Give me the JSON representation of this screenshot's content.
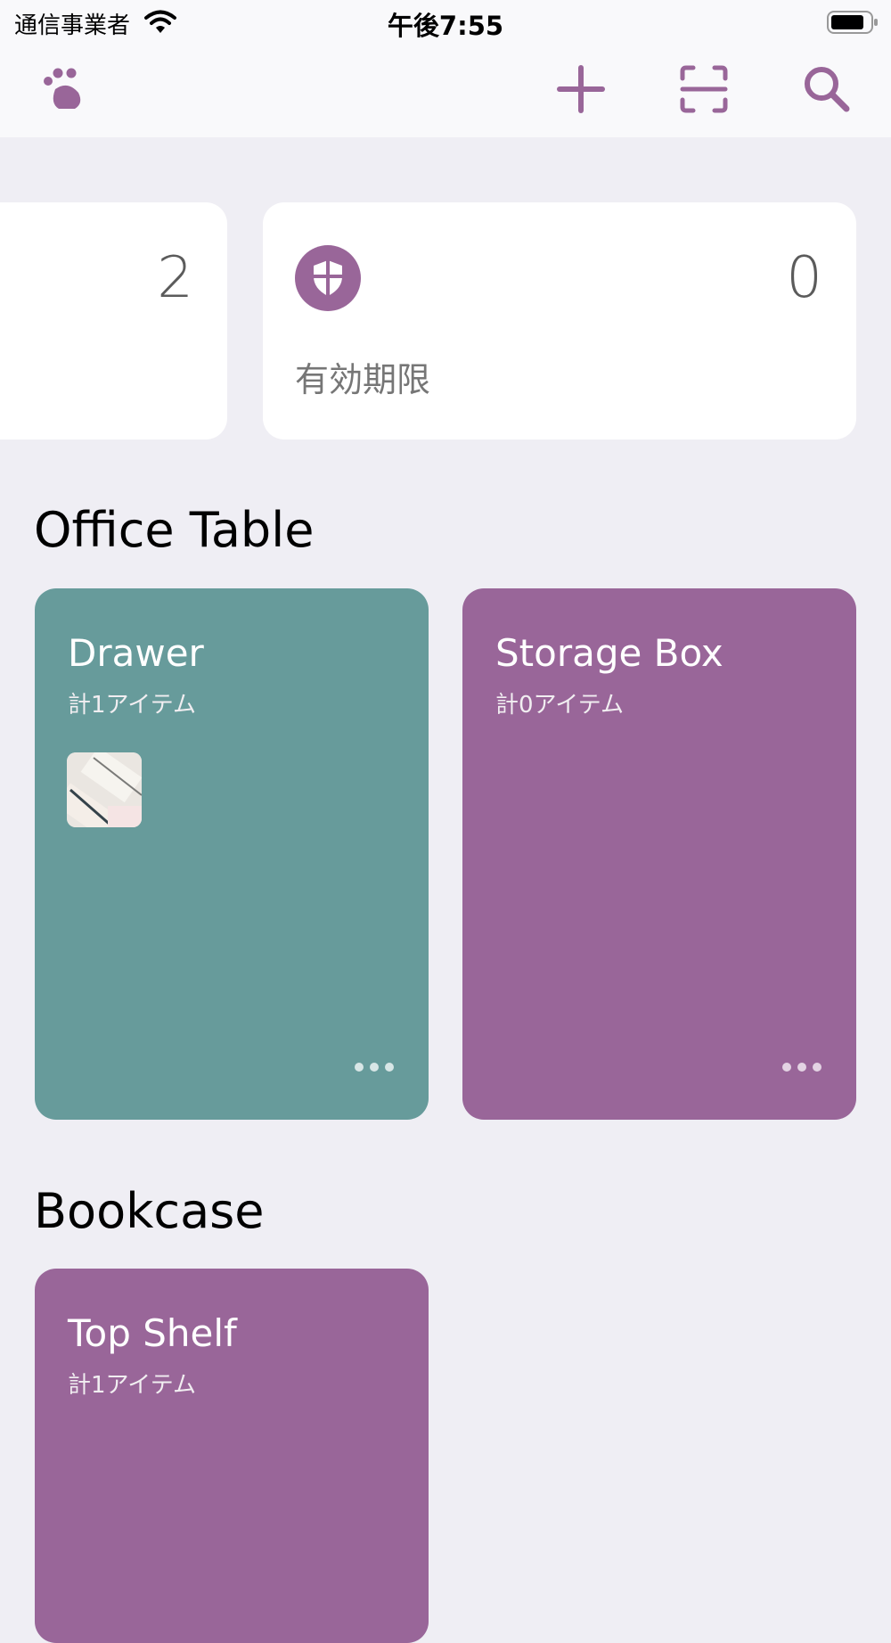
{
  "status_bar": {
    "carrier": "通信事業者",
    "time": "午後7:55"
  },
  "nav": {
    "icons": [
      "paw-icon",
      "plus-icon",
      "scan-icon",
      "search-icon"
    ]
  },
  "summary": {
    "left_count": "2",
    "right_count": "0",
    "right_label": "有効期限"
  },
  "sections": [
    {
      "title": "Office Table",
      "locations": [
        {
          "name": "Drawer",
          "count": "計1アイテム",
          "color": "#679b9b"
        },
        {
          "name": "Storage Box",
          "count": "計0アイテム",
          "color": "#996699"
        }
      ]
    },
    {
      "title": "Bookcase",
      "locations": [
        {
          "name": "Top Shelf",
          "count": "計1アイテム",
          "color": "#996699"
        }
      ]
    }
  ],
  "colors": {
    "accent": "#996699",
    "teal": "#679b9b",
    "background": "#efeef4"
  }
}
